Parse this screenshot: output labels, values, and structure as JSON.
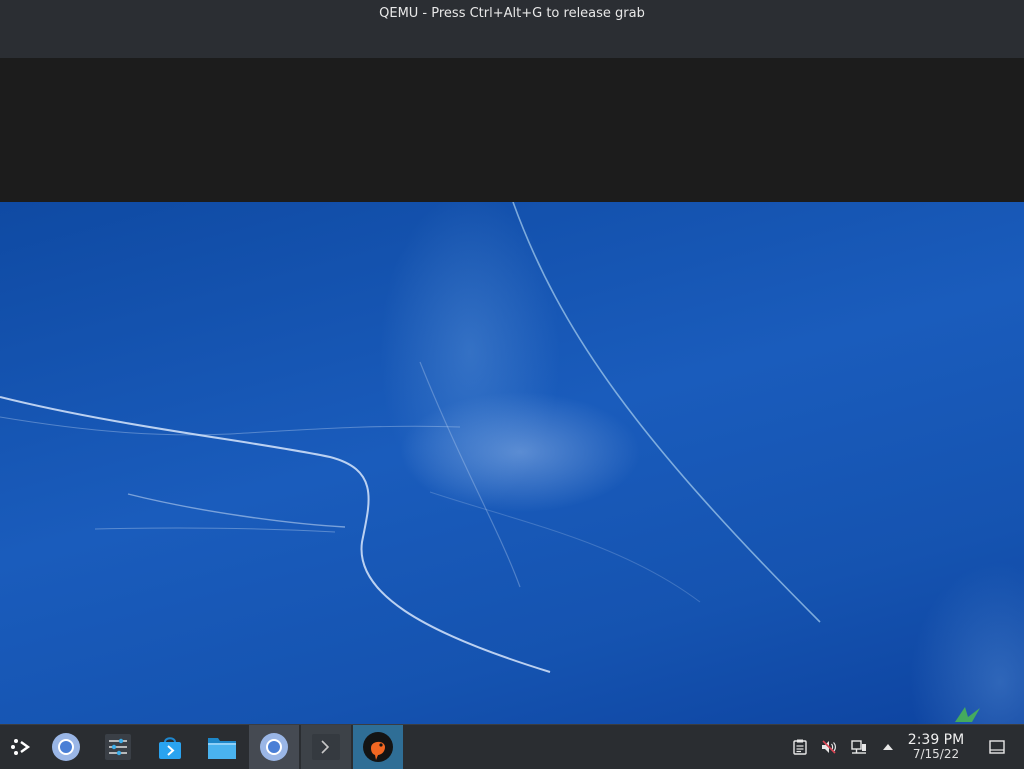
{
  "window": {
    "title": "QEMU - Press Ctrl+Alt+G to release grab"
  },
  "taskbar": {
    "launcher_icon": "app-launcher-icon",
    "apps": [
      {
        "name": "chromium",
        "icon": "chromium-icon"
      },
      {
        "name": "settings",
        "icon": "settings-sliders-icon"
      },
      {
        "name": "app-store",
        "icon": "store-bag-icon"
      },
      {
        "name": "file-manager",
        "icon": "folder-icon"
      },
      {
        "name": "chromium-window",
        "icon": "chromium-icon"
      },
      {
        "name": "terminal",
        "icon": "terminal-icon"
      },
      {
        "name": "qemu",
        "icon": "qemu-icon"
      }
    ],
    "tray": [
      "clipboard-icon",
      "volume-muted-icon",
      "network-icon",
      "tray-expand-icon"
    ],
    "clock": {
      "time": "2:39 PM",
      "date": "7/15/22"
    },
    "show_desktop_icon": "show-desktop-icon"
  },
  "colors": {
    "titlebar": "#2b2e33",
    "wallpaper": "#1553b0",
    "taskbar": "#2a2d31",
    "accent": "#3daee9"
  }
}
